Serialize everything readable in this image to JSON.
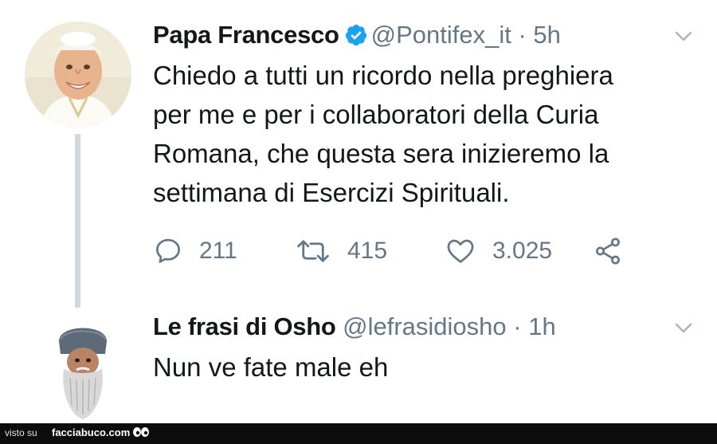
{
  "tweet1": {
    "name": "Papa Francesco",
    "handle": "@Pontifex_it",
    "separator": "·",
    "time": "5h",
    "text": "Chiedo a tutti un ricordo nella preghiera\nper me e per i collaboratori della Curia\nRomana, che questa sera inizieremo la\nsettimana di Esercizi Spirituali.",
    "replies": "211",
    "retweets": "415",
    "likes": "3.025"
  },
  "tweet2": {
    "name": "Le frasi di Osho",
    "handle": "@lefrasidiosho",
    "separator": "·",
    "time": "1h",
    "text": "Nun ve fate male eh"
  },
  "footer": {
    "prefix": "visto su",
    "brand": "facciabuco.com"
  },
  "colors": {
    "verified": "#1da1f2",
    "muted": "#657786",
    "thread_line": "#cfd9de",
    "footer_bg": "#0d0d0d"
  },
  "icons": [
    "verified-badge-icon",
    "chevron-down-icon",
    "reply-icon",
    "retweet-icon",
    "like-icon",
    "share-icon",
    "eyes-icon"
  ]
}
